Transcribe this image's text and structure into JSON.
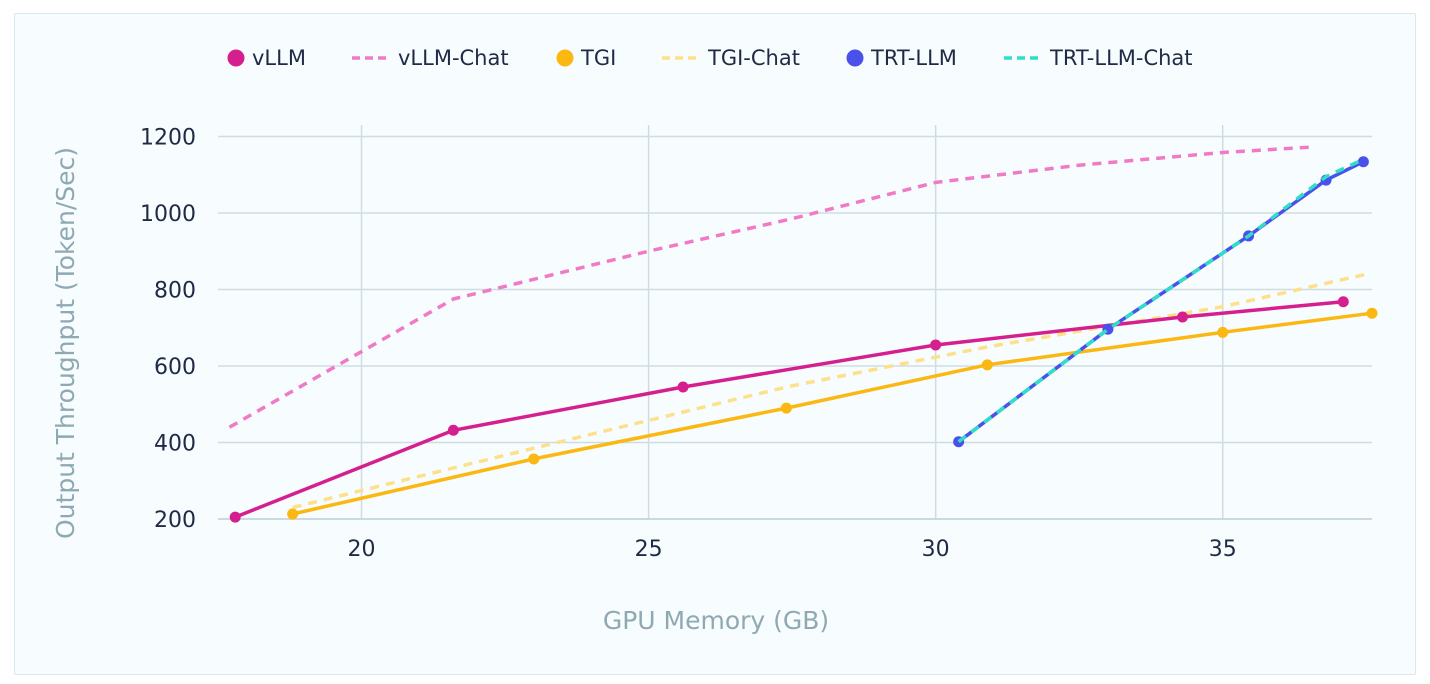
{
  "chart_data": {
    "type": "line",
    "title": "",
    "xlabel": "GPU Memory (GB)",
    "ylabel": "Output Throughput (Token/Sec)",
    "xlim": [
      17.5,
      37.6
    ],
    "ylim": [
      200,
      1230
    ],
    "xticks": [
      20,
      25,
      30,
      35
    ],
    "yticks": [
      200,
      400,
      600,
      800,
      1000,
      1200
    ],
    "grid": true,
    "legend": "top",
    "series": [
      {
        "name": "vLLM",
        "style": "solid-markers",
        "color": "#d61f8f",
        "x": [
          17.8,
          21.6,
          25.6,
          30.0,
          34.3,
          37.1
        ],
        "y": [
          205,
          432,
          545,
          655,
          728,
          768
        ]
      },
      {
        "name": "vLLM-Chat",
        "style": "dashed",
        "color": "#f07ac8",
        "x": [
          17.7,
          21.6,
          25.0,
          27.5,
          30.0,
          32.5,
          35.0,
          36.5
        ],
        "y": [
          440,
          775,
          900,
          985,
          1080,
          1125,
          1158,
          1172
        ]
      },
      {
        "name": "TGI",
        "style": "solid-markers",
        "color": "#fbb812",
        "x": [
          18.8,
          23.0,
          27.4,
          30.9,
          35.0,
          37.6
        ],
        "y": [
          213,
          357,
          490,
          603,
          688,
          738
        ]
      },
      {
        "name": "TGI-Chat",
        "style": "dashed",
        "color": "#fde08a",
        "x": [
          18.8,
          23.0,
          27.4,
          30.9,
          35.0,
          37.5
        ],
        "y": [
          230,
          385,
          545,
          650,
          755,
          840
        ]
      },
      {
        "name": "TRT-LLM",
        "style": "solid-markers",
        "color": "#4a50ea",
        "x": [
          30.4,
          33.0,
          35.45,
          36.8,
          37.45
        ],
        "y": [
          402,
          696,
          940,
          1086,
          1134
        ]
      },
      {
        "name": "TRT-LLM-Chat",
        "style": "dashed",
        "color": "#30ddc8",
        "x": [
          30.4,
          33.0,
          35.45,
          36.8,
          37.45
        ],
        "y": [
          402,
          696,
          940,
          1095,
          1140
        ]
      }
    ]
  }
}
